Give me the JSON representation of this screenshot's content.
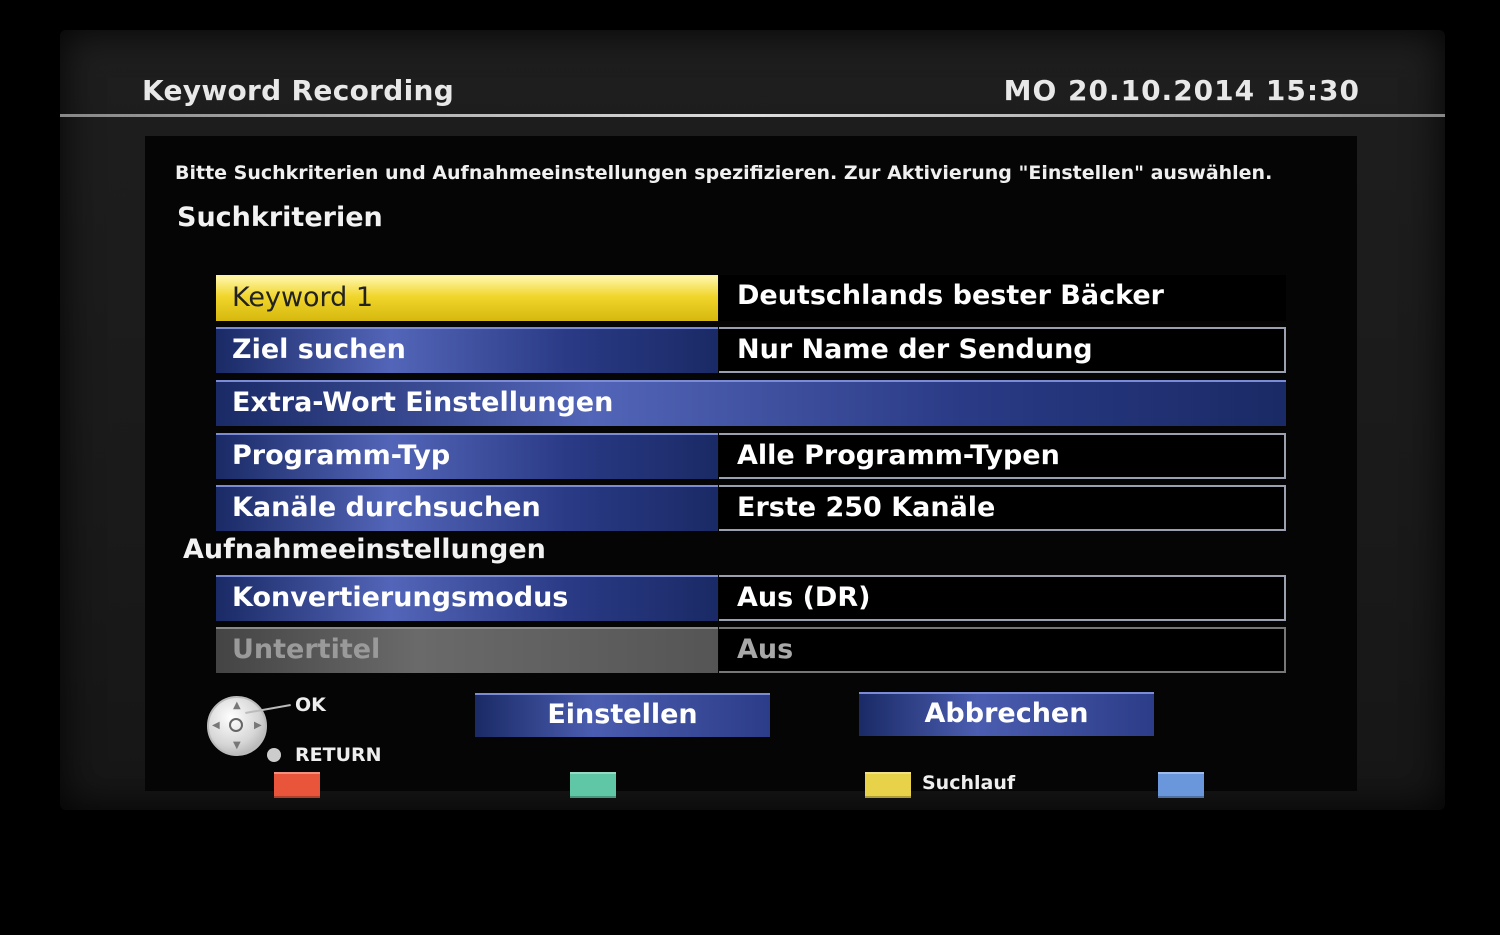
{
  "header": {
    "title": "Keyword Recording",
    "datetime": "MO 20.10.2014 15:30"
  },
  "instructions": "Bitte Suchkriterien und Aufnahmeeinstellungen spezifizieren. Zur Aktivierung \"Einstellen\" auswählen.",
  "sections": {
    "search": "Suchkriterien",
    "recording": "Aufnahmeeinstellungen"
  },
  "rows": [
    {
      "label": "Keyword 1",
      "value": "Deutschlands bester Bäcker"
    },
    {
      "label": "Ziel suchen",
      "value": "Nur Name der Sendung"
    },
    {
      "label": "Extra-Wort Einstellungen"
    },
    {
      "label": "Programm-Typ",
      "value": "Alle Programm-Typen"
    },
    {
      "label": "Kanäle durchsuchen",
      "value": "Erste 250 Kanäle"
    },
    {
      "label": "Konvertierungsmodus",
      "value": "Aus (DR)"
    },
    {
      "label": "Untertitel",
      "value": "Aus"
    }
  ],
  "buttons": {
    "confirm": "Einstellen",
    "cancel": "Abbrechen"
  },
  "help": {
    "ok": "OK",
    "return": "RETURN"
  },
  "color_keys": {
    "red": "#e8553a",
    "green": "#5fc7a6",
    "yellow": "#e8d24a",
    "yellow_label": "Suchlauf",
    "blue": "#6a96dc"
  },
  "colors": {
    "focus": "#f0d52a",
    "row_blue": "#2a3a85"
  },
  "icons": {
    "navigation": "dpad-icon",
    "return": "return-icon"
  }
}
